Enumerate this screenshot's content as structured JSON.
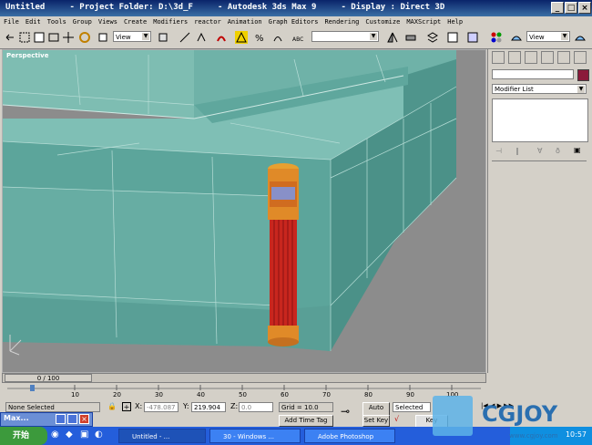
{
  "title_bar": {
    "text": "Untitled     - Project Folder: D:\\3d_F     - Autodesk 3ds Max 9     - Display : Direct 3D",
    "min_label": "_",
    "max_label": "□",
    "close_label": "×"
  },
  "menu": [
    "File",
    "Edit",
    "Tools",
    "Group",
    "Views",
    "Create",
    "Modifiers",
    "reactor",
    "Animation",
    "Graph Editors",
    "Rendering",
    "Customize",
    "MAXScript",
    "Help"
  ],
  "toolbar": {
    "refcoord_left": "View",
    "refcoord_right": "View",
    "named_selection": ""
  },
  "viewport": {
    "label": "Perspective"
  },
  "command_panel": {
    "name_field": "",
    "color_swatch": "#8b1a3a",
    "modifier_list": "Modifier List"
  },
  "time_slider": {
    "frame": "0 / 100"
  },
  "ruler": {
    "ticks": [
      "10",
      "20",
      "30",
      "40",
      "50",
      "60",
      "70",
      "80",
      "90",
      "100"
    ]
  },
  "status": {
    "selection": "None Selected",
    "prompt": "ate objects",
    "x_label": "X:",
    "x_value": "-478.087",
    "y_label": "Y:",
    "y_value": "219.904",
    "z_label": "Z:",
    "z_value": "0.0",
    "grid": "Grid = 10.0",
    "add_time_tag": "Add Time Tag",
    "auto_key": "Auto Key",
    "set_key": "Set Key",
    "selected_field": "Selected",
    "key_filters": "Key Filters..."
  },
  "mini_window": {
    "label": "Max..."
  },
  "taskbar": {
    "start": "开始",
    "tasks": [
      "Untitled - ...",
      "30 - Windows ...",
      "Adobe Photoshop"
    ],
    "clock": "10:57"
  },
  "watermark": {
    "brand": "CGJOY",
    "url": "www.cgjoy.com"
  }
}
